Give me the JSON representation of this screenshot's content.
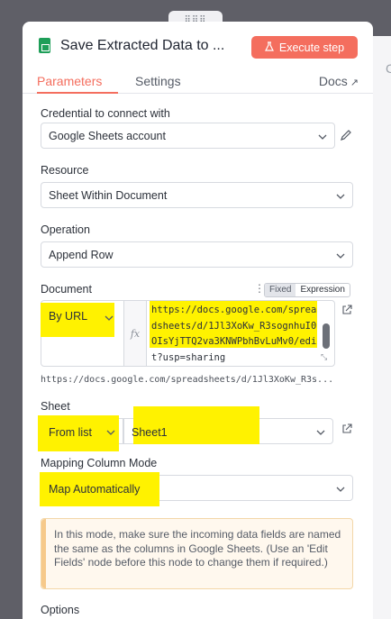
{
  "node": {
    "title": "Save Extracted Data to ...",
    "execute_label": "Execute step"
  },
  "tabs": {
    "parameters": "Parameters",
    "settings": "Settings",
    "docs": "Docs"
  },
  "credential": {
    "label": "Credential to connect with",
    "value": "Google Sheets account"
  },
  "resource": {
    "label": "Resource",
    "value": "Sheet Within Document"
  },
  "operation": {
    "label": "Operation",
    "value": "Append Row"
  },
  "document": {
    "label": "Document",
    "mode": "By URL",
    "fixed_label": "Fixed",
    "expression_label": "Expression",
    "url_value": "https://docs.google.com/spreadsheets/d/1Jl3XoKw_R3sognhuI0OIsYjTTQ2va3KNWPbhBvLuMv0/edit?usp=sharing",
    "preview": "https://docs.google.com/spreadsheets/d/1Jl3XoKw_R3s..."
  },
  "sheet": {
    "label": "Sheet",
    "mode": "From list",
    "value": "Sheet1"
  },
  "mapping": {
    "label": "Mapping Column Mode",
    "value": "Map Automatically"
  },
  "notice": {
    "text": "In this mode, make sure the incoming data fields are named the same as the columns in Google Sheets. (Use an 'Edit Fields' node before this node to change them if required.)"
  },
  "options": {
    "label": "Options"
  },
  "colors": {
    "accent": "#f46e5e",
    "highlight": "#fff200",
    "sheets_green": "#1e9e58"
  },
  "icons": [
    "google-sheets-icon",
    "flask-icon",
    "external-link-icon",
    "chevron-down-icon",
    "pencil-icon",
    "kebab-menu-icon",
    "fx-icon",
    "resize-icon"
  ]
}
